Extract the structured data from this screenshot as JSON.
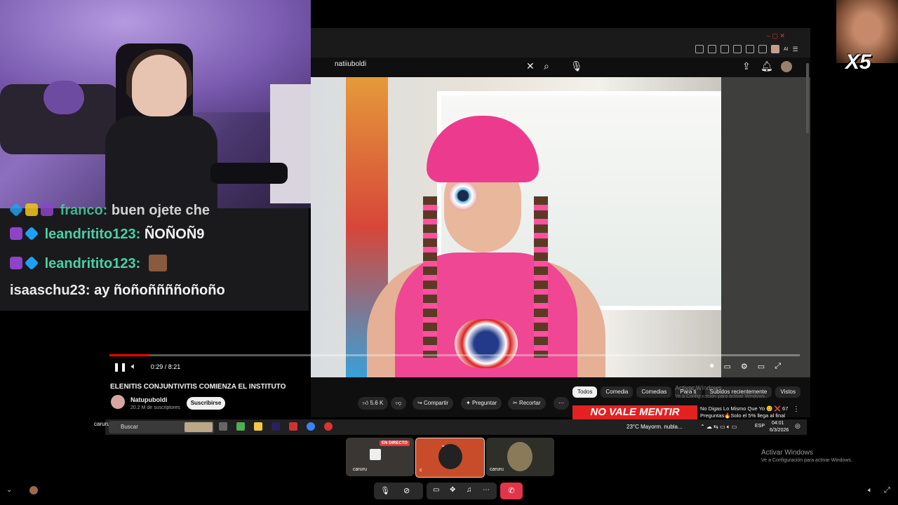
{
  "chat": {
    "lines": [
      {
        "user": "franco:",
        "msg": "buen ojete che"
      },
      {
        "user": "leandritito123:",
        "msg": "ÑOÑOÑ9"
      },
      {
        "user": "leandritito123:",
        "msg": ""
      },
      {
        "user": "isaaschu23:",
        "msg": "ay ñoñoññññoñoño"
      }
    ]
  },
  "browser": {
    "search_value": "natiiuboldi",
    "video": {
      "time": "0:29 / 8:21",
      "progress": 0.058,
      "title": "ELENITIS CONJUNTIVITIS COMIENZA EL INSTITUTO",
      "channel": "Natupuboldi",
      "subscribers": "20.2 M de suscriptores",
      "subscribe_label": "Suscribirse",
      "likes": "5.6 K",
      "share_label": "Compartir",
      "ask_label": "Preguntar",
      "clip_label": "Recortar"
    },
    "chips": [
      "Todos",
      "Comedia",
      "Comedias",
      "Para ti",
      "Subidos recientemente",
      "Vistos"
    ],
    "watermark_title": "Activar Windows",
    "watermark_sub": "Ve a Configuración para activar Windows.",
    "recommended": {
      "thumb_text": "NO VALE MENTIR",
      "title": "No Digas Lo Mismo Que Yo 😊 ❌ 67 Preguntas🔥Solo el 5% llega al final"
    },
    "top_ai": "AI"
  },
  "taskbar": {
    "user_label": "caruru",
    "search_placeholder": "Buscar",
    "weather": "23°C  Mayorm. nubla...",
    "lang": "ESP",
    "time": "04:01",
    "date": "6/3/2026"
  },
  "call": {
    "live_badge": "EN DIRECTO",
    "tile1_name": "caruru",
    "tile2_name": "c",
    "tile3_name": "caruru"
  },
  "activate": {
    "title": "Activar Windows",
    "sub": "Ve a Configuración para activar Windows."
  },
  "meme": {
    "text": "X5"
  },
  "colors": {
    "chat_user": "#4ad0a4",
    "youtube_red": "#ff0000",
    "leave_red": "#e2344a"
  }
}
